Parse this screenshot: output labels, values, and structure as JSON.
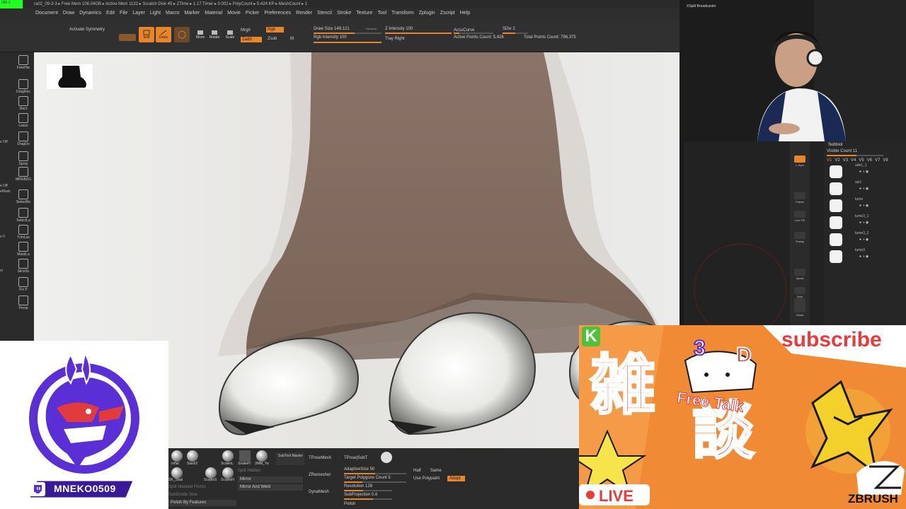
{
  "titlebar": {
    "text": "ra02_09-3-3  ▸ Free Mem 106.04GB ▸ Active Mem 1132 ▸ Scratch Disk 45 ▸ ZTime ▸ 1.17 Timer ▸ 0.002 ▸ PolyCount ▸ 5.424 KP ▸ MeshCount ▸ 1",
    "left_text": "025.2"
  },
  "menu": [
    "Document",
    "Draw",
    "Dynamics",
    "Edit",
    "File",
    "Layer",
    "Light",
    "Macro",
    "Marker",
    "Material",
    "Movie",
    "Picker",
    "Preferences",
    "Render",
    "Stencil",
    "Stroke",
    "Texture",
    "Tool",
    "Transform",
    "Zplugin",
    "Zscript",
    "Help"
  ],
  "toolbar": {
    "activate_symmetry": "Activate Symmetry",
    "edit": "Edit",
    "draw": "Draw",
    "move": "Move",
    "rotate": "Rotate",
    "scale": "Scale",
    "mrgb": "Mrgb",
    "rgb": "Rgb",
    "zadd": "Zadd",
    "zsub": "Zsub",
    "m": "M",
    "draw_size_label": "Draw Size",
    "draw_size": "149.121",
    "dynamic": "Dynamic",
    "rgb_intensity_label": "Rgb Intensity",
    "rgb_intensity": "100",
    "z_intensity_label": "Z Intensity",
    "z_intensity": "100",
    "tray_right": "Tray Right",
    "accucurve": "AccuCurve",
    "active_points_label": "Active Points Count:",
    "active_points": "5,426",
    "sdiv_label": "SDiv",
    "sdiv": "2",
    "total_points_label": "Total Points Count:",
    "total_points": "796,375"
  },
  "left_shelf": {
    "buttons": [
      "FreeHar",
      "DragRec",
      "Rect",
      "Lasso",
      "DragDo",
      "Spray",
      "MRGBZG",
      "SelectRe",
      "SelectLa",
      "TrimLas",
      "MaskLa",
      "SliceSc",
      "Fix P",
      "Persp"
    ],
    "labels": [
      "e Off",
      "e Off",
      "eMask",
      "e 0",
      "st"
    ]
  },
  "webcam": {
    "label": "XSplit Broadcaster"
  },
  "right_shelf": {
    "buttons": [
      "L.Sym",
      "Frame",
      "Line Fill",
      "Transp",
      "Xpose",
      "Solo",
      "Dynamic",
      "Ghost"
    ]
  },
  "subtool": {
    "title": "Subtool",
    "visible_count_label": "Visible Count",
    "visible_count": "11",
    "versions": [
      "V1",
      "V2",
      "V3",
      "V4",
      "V5",
      "V6",
      "V7",
      "V8"
    ],
    "items": [
      "ude1_1",
      "asi1",
      "tume",
      "tume3_1",
      "tume3_2",
      "tume3"
    ]
  },
  "bottom_panel": {
    "brushes": [
      "Inflat",
      "Slash2",
      "ScalesL",
      "SnakeH",
      "3MM_Ya",
      "SK_Slasl",
      "ScalesS",
      "ScalesFi"
    ],
    "subtool_master": "SubTool Master",
    "tpose_mesh": "TPoseMesh",
    "tpose_subt": "TPose|SubT",
    "split_hidden": "Split Hidden",
    "mirror": "Mirror",
    "split_masked_points": "Split Masked Points",
    "mirror_and_weld": "Mirror And Weld",
    "subdivide_size": "SubDivide Size",
    "polish_by_features": "Polish By Features",
    "zremesher": "ZRemesher",
    "dynamesh": "DynaMesh",
    "adaptive_size_label": "AdaptiveSize",
    "adaptive_size": "50",
    "target_polygons_label": "Target Polygons Count",
    "target_polygons": "5",
    "resolution_label": "Resolution",
    "resolution": "128",
    "subprojection_label": "SubProjection",
    "subprojection": "0.6",
    "polish": "Polish",
    "half": "Half",
    "same": "Same",
    "use_polypaint": "Use Polypaint",
    "adapt": "Adapt"
  },
  "logo": {
    "channel": "MNEKO0509"
  },
  "banner": {
    "k": "K",
    "three_d_3": "3",
    "three_d_d": "D",
    "subscribe": "subscribe",
    "zatsu": "雑",
    "dan": "談",
    "free_talk": "Free Talk",
    "live": "LIVE",
    "zbrush": "ZBRUSH"
  },
  "colors": {
    "accent": "#e8852a",
    "banner_bg": "#f08a34",
    "logo_purple": "#5b2fd6"
  }
}
